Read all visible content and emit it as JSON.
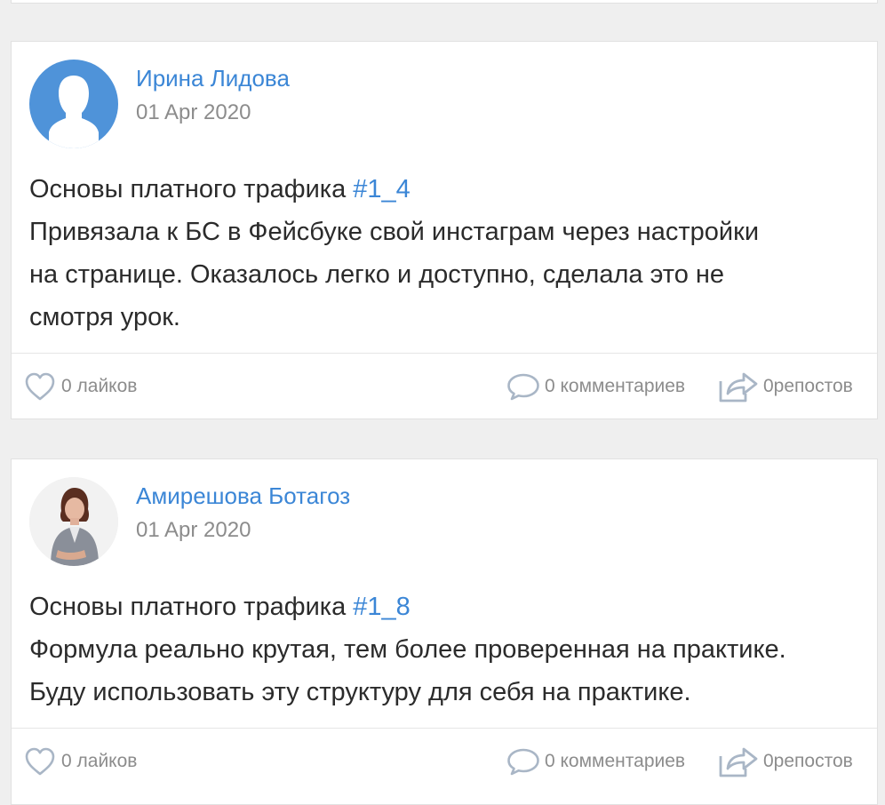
{
  "posts": [
    {
      "author": "Ирина Лидова",
      "date": "01 Apr 2020",
      "text_prefix": "Основы платного трафика ",
      "hashtag": "#1_4",
      "lines": [
        "Привязала к БС в Фейсбуке свой инстаграм через настройки",
        "на странице. Оказалось легко и доступно, сделала это не",
        "смотря урок."
      ],
      "likes_label": "0 лайков",
      "comments_label": "0 комментариев",
      "reposts_label": "0репостов"
    },
    {
      "author": "Амирешова Ботагоз",
      "date": "01 Apr 2020",
      "text_prefix": "Основы платного трафика ",
      "hashtag": "#1_8",
      "lines": [
        "Формула реально крутая, тем более проверенная на практике.",
        "Буду использовать  эту структуру для себя на практике."
      ],
      "likes_label": "0 лайков",
      "comments_label": "0 комментариев",
      "reposts_label": "0репостов"
    }
  ],
  "colors": {
    "accent": "#3b86d6",
    "muted": "#8c8c8c",
    "icon": "#a9b6c6",
    "avatar_default": "#4f93d9"
  },
  "icons": {
    "like": "heart-icon",
    "comment": "speech-bubble-icon",
    "repost": "share-arrow-icon"
  }
}
